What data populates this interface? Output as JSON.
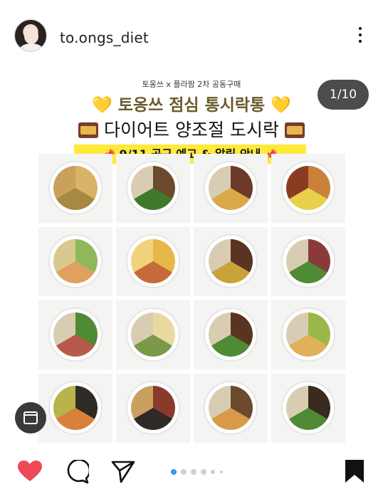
{
  "header": {
    "username": "to.ongs_diet",
    "avatar_icon": "profile-avatar",
    "more_icon": "more-vertical-icon"
  },
  "post": {
    "subtitle": "토옹쓰 x 플라팜 2차 공동구매",
    "title_line1": "토옹쓰 점심 통시락통",
    "title_line2": "다이어트 양조절 도시락",
    "banner": "9/11 공구 예고 & 알림 안내",
    "heart_emoji": "💛",
    "pin_emoji": "📌",
    "counter": "1/10",
    "tiles_count_note": "16 photo tiles of diet lunch containers"
  },
  "actions": {
    "like_icon": "heart-filled-icon",
    "comment_icon": "comment-icon",
    "share_icon": "send-icon",
    "save_icon": "bookmark-icon",
    "calendar_icon": "calendar-icon",
    "like_color": "#ed4956",
    "active_dot_color": "#3897f0"
  }
}
